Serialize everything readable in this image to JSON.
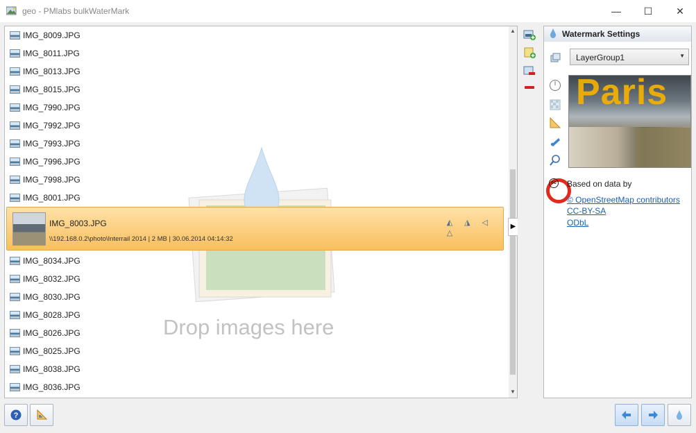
{
  "window": {
    "title": "geo - PMlabs bulkWaterMark",
    "min_glyph": "—",
    "max_glyph": "☐",
    "close_glyph": "✕"
  },
  "file_list": {
    "items_before": [
      "IMG_8009.JPG",
      "IMG_8011.JPG",
      "IMG_8013.JPG",
      "IMG_8015.JPG",
      "IMG_7990.JPG",
      "IMG_7992.JPG",
      "IMG_7993.JPG",
      "IMG_7996.JPG",
      "IMG_7998.JPG",
      "IMG_8001.JPG"
    ],
    "selected": {
      "name": "IMG_8003.JPG",
      "info": "\\\\192.168.0.2\\photo\\Interrail 2014 | 2 MB | 30.06.2014 04:14:32",
      "action_icons": [
        "flip-horizontal-icon",
        "flip-vertical-icon",
        "rotate-left-icon",
        "rotate-right-icon"
      ]
    },
    "items_after": [
      "IMG_8034.JPG",
      "IMG_8032.JPG",
      "IMG_8030.JPG",
      "IMG_8028.JPG",
      "IMG_8026.JPG",
      "IMG_8025.JPG",
      "IMG_8038.JPG",
      "IMG_8036.JPG"
    ],
    "drop_hint": "Drop images here"
  },
  "side_tools": [
    "add-images-icon",
    "add-folder-icon",
    "remove-image-icon",
    "remove-all-icon"
  ],
  "settings": {
    "title": "Watermark Settings",
    "layer_group": "LayerGroup1",
    "preview_watermark_text": "Paris",
    "vertical_tools": [
      "position-icon",
      "opacity-icon",
      "rotate-triangle-icon",
      "map-pin-icon",
      "zoom-icon"
    ],
    "attribution": {
      "label": "Based on data by",
      "links": [
        "© OpenStreetMap contributors",
        "CC-BY-SA",
        "ODbL"
      ]
    }
  },
  "bottom_bar": {
    "left_buttons": [
      "help-icon",
      "settings-triangle-icon"
    ],
    "right_buttons": [
      "back-arrow-icon",
      "forward-arrow-icon",
      "watermark-drop-icon"
    ]
  },
  "colors": {
    "selected_row_top": "#ffe1a7",
    "selected_row_bottom": "#f8bf5e",
    "link": "#1a5fb4",
    "highlight_circle": "#e12a1b",
    "watermark_text": "#f5b100"
  }
}
